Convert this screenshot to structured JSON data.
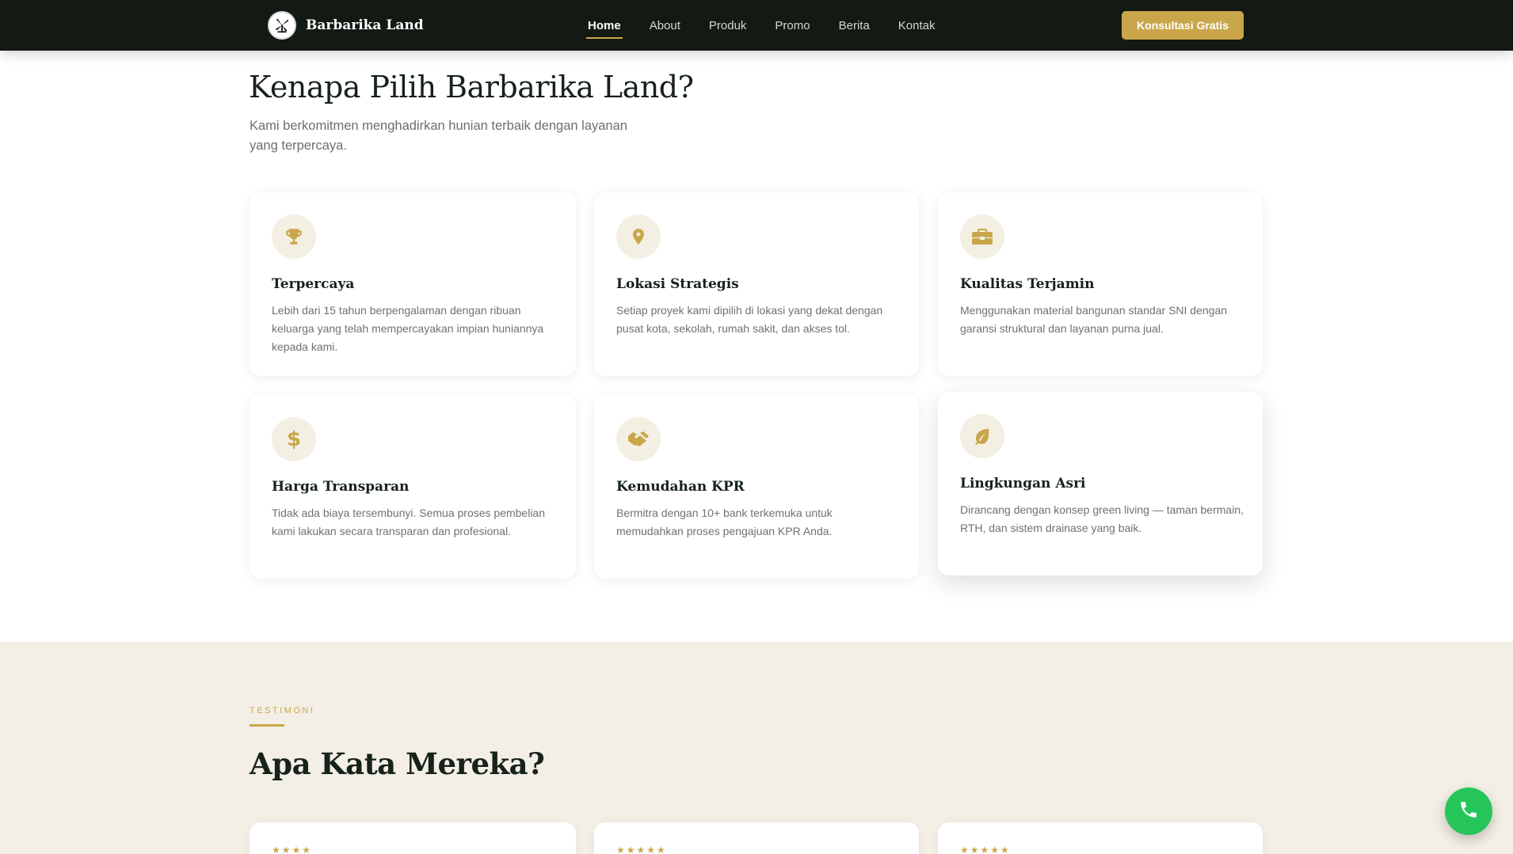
{
  "brand": {
    "name": "Barbarika Land",
    "logo_icon": "windmill-logo-icon"
  },
  "nav": {
    "items": [
      {
        "label": "Home",
        "active": true
      },
      {
        "label": "About"
      },
      {
        "label": "Produk"
      },
      {
        "label": "Promo"
      },
      {
        "label": "Berita"
      },
      {
        "label": "Kontak"
      }
    ],
    "cta_label": "Konsultasi Gratis"
  },
  "features": {
    "title": "Kenapa Pilih Barbarika Land?",
    "subtitle": "Kami berkomitmen menghadirkan hunian terbaik dengan layanan yang terpercaya.",
    "cards": [
      {
        "icon": "trophy-icon",
        "title": "Terpercaya",
        "description": "Lebih dari 15 tahun berpengalaman dengan ribuan keluarga yang telah mempercayakan impian huniannya kepada kami."
      },
      {
        "icon": "map-pin-icon",
        "title": "Lokasi Strategis",
        "description": "Setiap proyek kami dipilih di lokasi yang dekat dengan pusat kota, sekolah, rumah sakit, dan akses tol."
      },
      {
        "icon": "toolbox-icon",
        "title": "Kualitas Terjamin",
        "description": "Menggunakan material bangunan standar SNI dengan garansi struktural dan layanan purna jual."
      },
      {
        "icon": "dollar-icon",
        "title": "Harga Transparan",
        "description": "Tidak ada biaya tersembunyi. Semua proses pembelian kami lakukan secara transparan dan profesional."
      },
      {
        "icon": "handshake-icon",
        "title": "Kemudahan KPR",
        "description": "Bermitra dengan 10+ bank terkemuka untuk memudahkan proses pengajuan KPR Anda."
      },
      {
        "icon": "leaf-icon",
        "title": "Lingkungan Asri",
        "description": "Dirancang dengan konsep green living — taman bermain, RTH, dan sistem drainase yang baik."
      }
    ]
  },
  "testimoni": {
    "eyebrow": "TESTIMONI",
    "title": "Apa Kata Mereka?",
    "cards": [
      {
        "stars": "★★★★"
      },
      {
        "stars": "★★★★★"
      },
      {
        "stars": "★★★★★"
      }
    ]
  },
  "floating_button": {
    "icon": "phone-icon"
  },
  "colors": {
    "accent": "#c9a64a",
    "navbar": "#131a14",
    "section_bg": "#f3efe6",
    "whatsapp": "#25c55a"
  }
}
